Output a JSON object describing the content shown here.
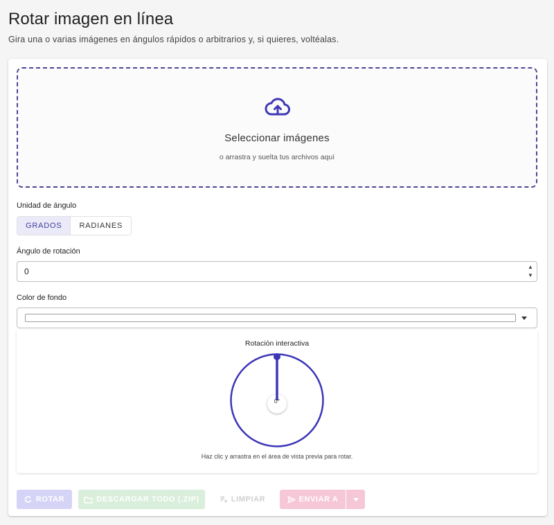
{
  "header": {
    "title": "Rotar imagen en línea",
    "subtitle": "Gira una o varias imágenes en ángulos rápidos o arbitrarios y, si quieres, voltéalas."
  },
  "dropzone": {
    "title": "Seleccionar imágenes",
    "hint": "o arrastra y suelta tus archivos aquí"
  },
  "angle_unit": {
    "label": "Unidad de ángulo",
    "options": [
      "GRADOS",
      "RADIANES"
    ],
    "selected": "GRADOS"
  },
  "rotation_angle": {
    "label": "Ángulo de rotación",
    "value": "0"
  },
  "background_color": {
    "label": "Color de fondo",
    "value": "#ffffff"
  },
  "preview": {
    "title": "Rotación interactiva",
    "angle_readout": "0°",
    "hint": "Haz clic y arrastra en el área de vista previa para rotar."
  },
  "actions": {
    "rotate": "ROTAR",
    "download_zip": "DESCARGAR TODO (.ZIP)",
    "clear": "LIMPIAR",
    "send_to": "ENVIAR A"
  },
  "colors": {
    "accent": "#3f3a9e",
    "dial": "#3c35b8",
    "rotate_disabled": "#d6d4f6",
    "zip_disabled": "#d9eedb",
    "send_disabled": "#f6c7d6"
  }
}
